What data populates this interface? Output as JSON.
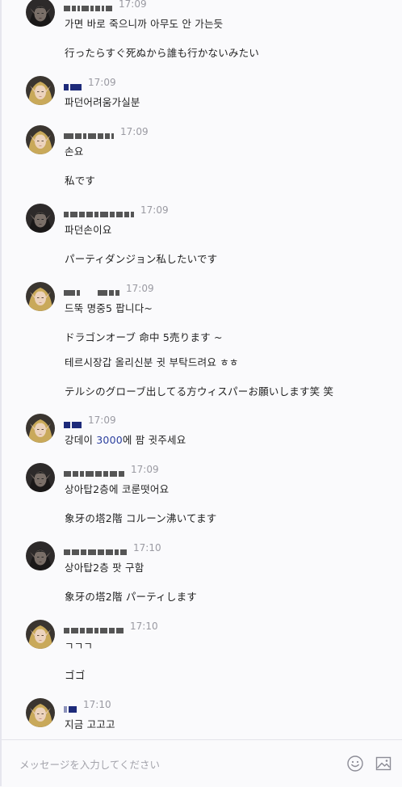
{
  "composer": {
    "placeholder": "メッセージを入力してください",
    "emoji_icon": "smiley-icon",
    "image_icon": "image-icon"
  },
  "avatar_types": {
    "dark": "dark-elf-avatar",
    "blonde": "blonde-elf-avatar"
  },
  "messages": [
    {
      "avatar": "dark",
      "time": "17:09",
      "lines": [
        "가면 바로 죽으니까 아무도 안 가는듯",
        "行ったらすぐ死ぬから誰も行かないみたい"
      ]
    },
    {
      "avatar": "blonde",
      "time": "17:09",
      "lines": [
        "파던어려움가실분"
      ]
    },
    {
      "avatar": "blonde",
      "time": "17:09",
      "lines": [
        "손요",
        "私です"
      ]
    },
    {
      "avatar": "dark",
      "time": "17:09",
      "lines": [
        "파던손이요",
        "パーティダンジョン私したいです"
      ]
    },
    {
      "avatar": "blonde",
      "time": "17:09",
      "lines": [
        "드뚝 명중5 팝니다~",
        "ドラゴンオーブ 命中 5売ります ~",
        "테르시장갑 올리신분 귓 부탁드려요 ㅎㅎ",
        "テルシのグローブ出してる方ウィスパーお願いします笑 笑"
      ]
    },
    {
      "avatar": "blonde",
      "time": "17:09",
      "lines": [
        "강데이 3000에 팜 귓주세요"
      ]
    },
    {
      "avatar": "dark",
      "time": "17:09",
      "lines": [
        "상아탑2층에 코룬떳어요",
        "象牙の塔2階 コルーン沸いてます"
      ]
    },
    {
      "avatar": "dark",
      "time": "17:10",
      "lines": [
        "상아탑2층 팟 구함",
        "象牙の塔2階 パーティします"
      ]
    },
    {
      "avatar": "blonde",
      "time": "17:10",
      "lines": [
        "ㄱㄱㄱ",
        "ゴゴ"
      ]
    },
    {
      "avatar": "blonde",
      "time": "17:10",
      "lines": [
        "지금 고고고"
      ]
    }
  ]
}
